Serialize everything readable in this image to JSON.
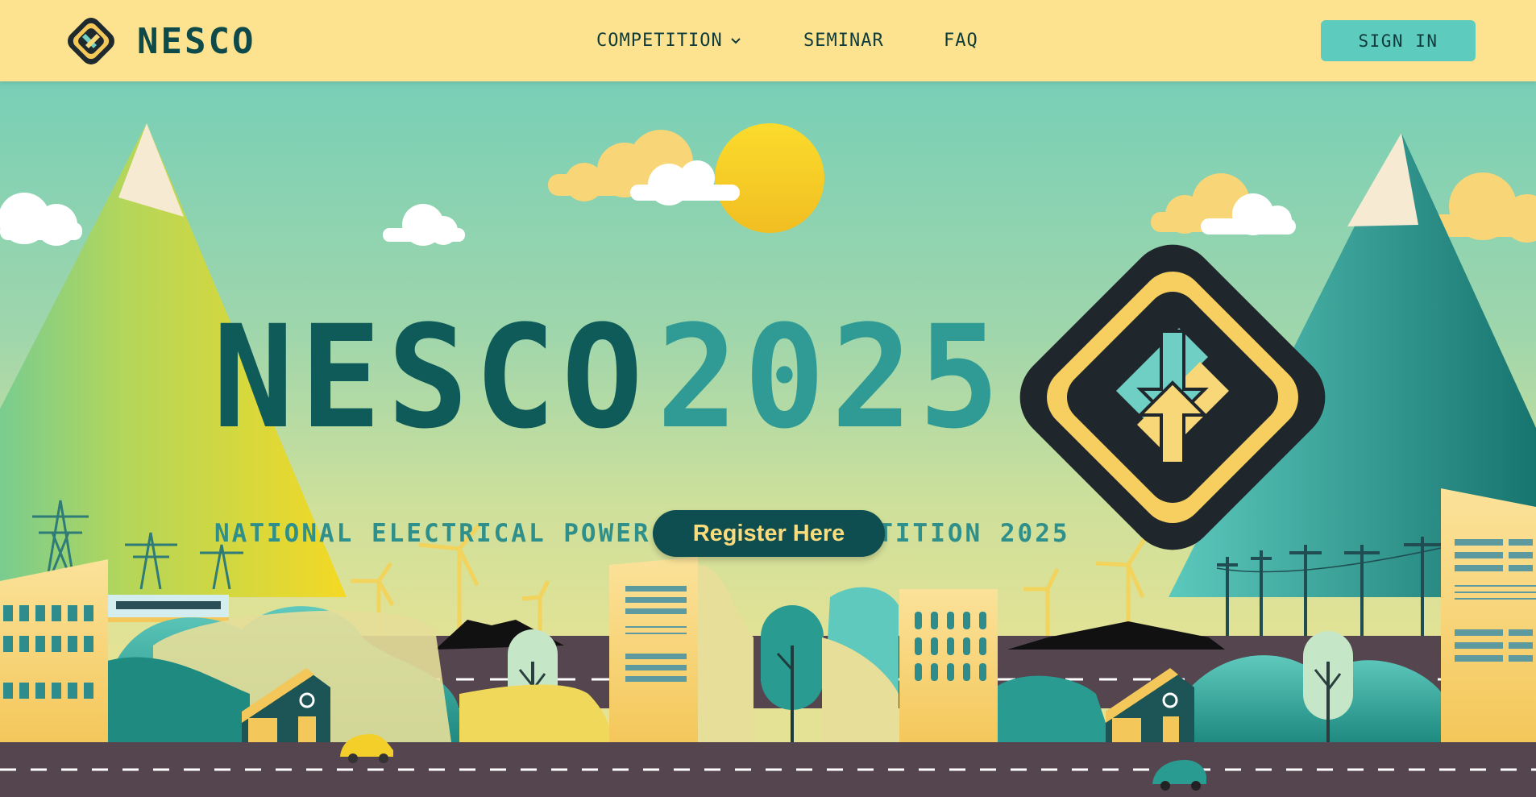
{
  "brand": {
    "name": "NESCO",
    "logo_icon": "nesco-diamond-logo-icon"
  },
  "nav": {
    "competition": "COMPETITION",
    "competition_icon": "chevron-down-icon",
    "seminar": "SEMINAR",
    "faq": "FAQ",
    "sign_in": "SIGN IN"
  },
  "hero": {
    "title_word": "NESCO",
    "title_year": "2025",
    "subtitle": "NATIONAL ELECTRICAL POWER SYSTEM COMPETITION 2025",
    "register_label": "Register Here",
    "emblem_icon": "nesco-emblem-icon"
  },
  "colors": {
    "navbar_bg": "#fde38f",
    "sky_top": "#78cfb6",
    "accent_teal": "#5ecbbf",
    "dark_teal": "#0f4e50",
    "sun_yellow": "#f6c928",
    "road": "#54454f"
  }
}
